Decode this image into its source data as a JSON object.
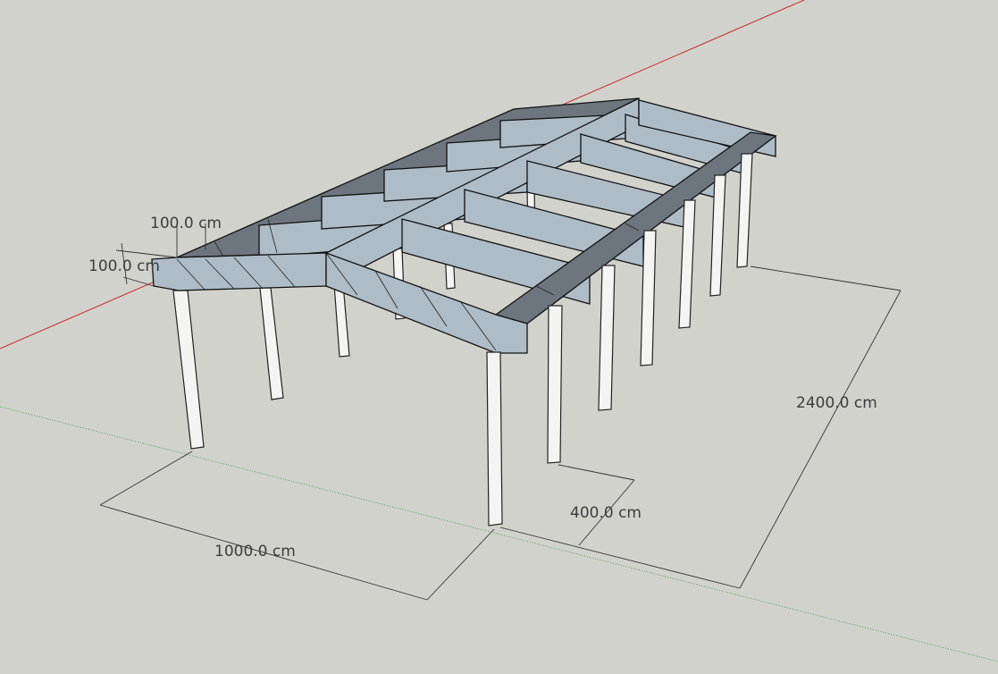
{
  "viewport": {
    "background": "#d2d2cd",
    "axis_colors": {
      "red": "#c8282a",
      "green": "#3fa03f"
    },
    "beam_colors": {
      "light": "#aebcc7",
      "dark": "#6d767e"
    },
    "dimensions": {
      "beam_width": "100.0 cm",
      "beam_height": "100.0 cm",
      "span_width": "1000.0 cm",
      "column_spacing": "400.0 cm",
      "total_length": "2400.0 cm"
    }
  }
}
